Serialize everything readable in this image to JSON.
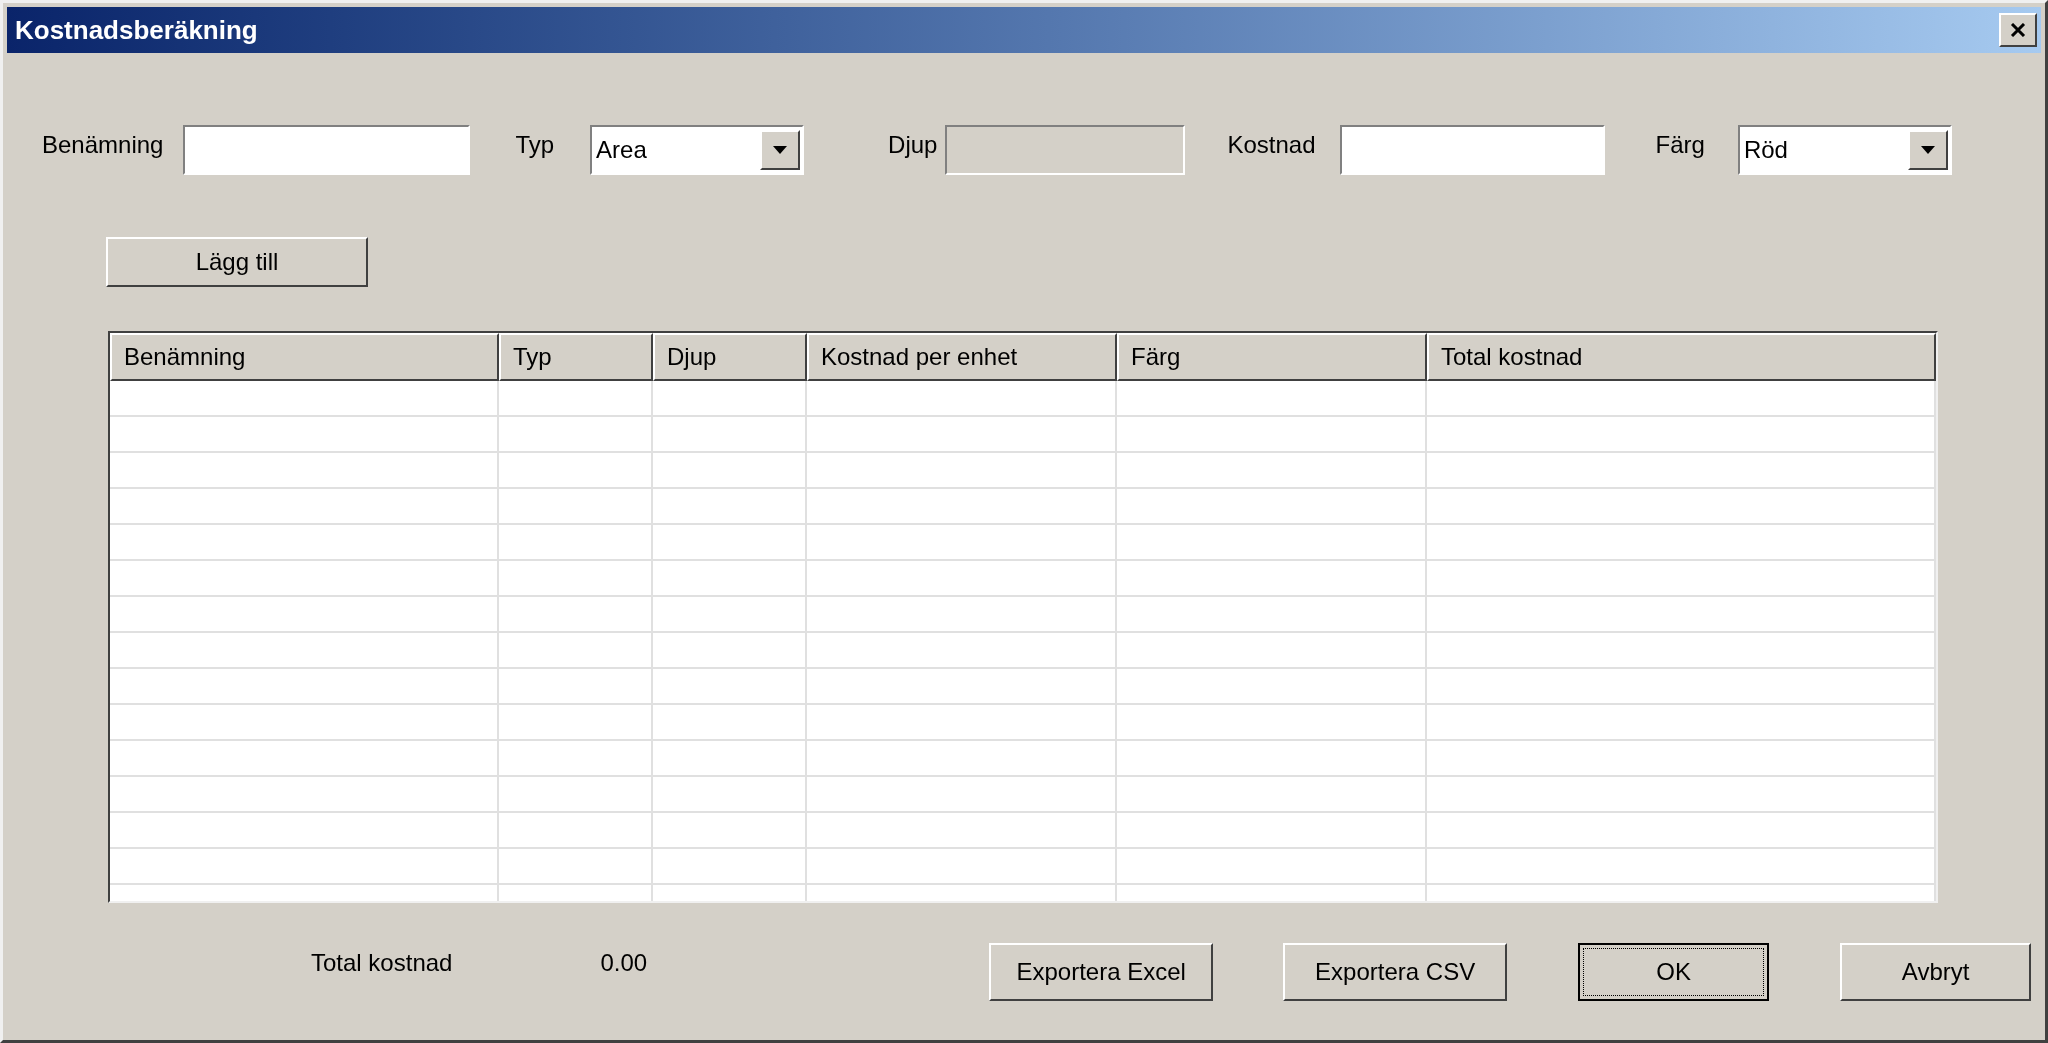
{
  "window": {
    "title": "Kostnadsberäkning"
  },
  "form": [
    {
      "label": "Benämning",
      "kind": "text",
      "disabled": false
    },
    {
      "label": "Typ",
      "kind": "select",
      "value": "Area"
    },
    {
      "label": "Djup",
      "kind": "text",
      "disabled": true
    },
    {
      "label": "Kostnad",
      "kind": "text",
      "disabled": false
    },
    {
      "label": "Färg",
      "kind": "select",
      "value": "Röd"
    }
  ],
  "add_button": "Lägg till",
  "table": {
    "columns": [
      "Benämning",
      "Typ",
      "Djup",
      "Kostnad per enhet",
      "Färg",
      "Total kostnad"
    ]
  },
  "total": {
    "label": "Total kostnad",
    "value": "0.00"
  },
  "buttons": [
    {
      "label": "Exportera Excel",
      "focused": false
    },
    {
      "label": "Exportera CSV",
      "focused": false
    },
    {
      "label": "OK",
      "focused": true
    },
    {
      "label": "Avbryt",
      "focused": false
    }
  ]
}
